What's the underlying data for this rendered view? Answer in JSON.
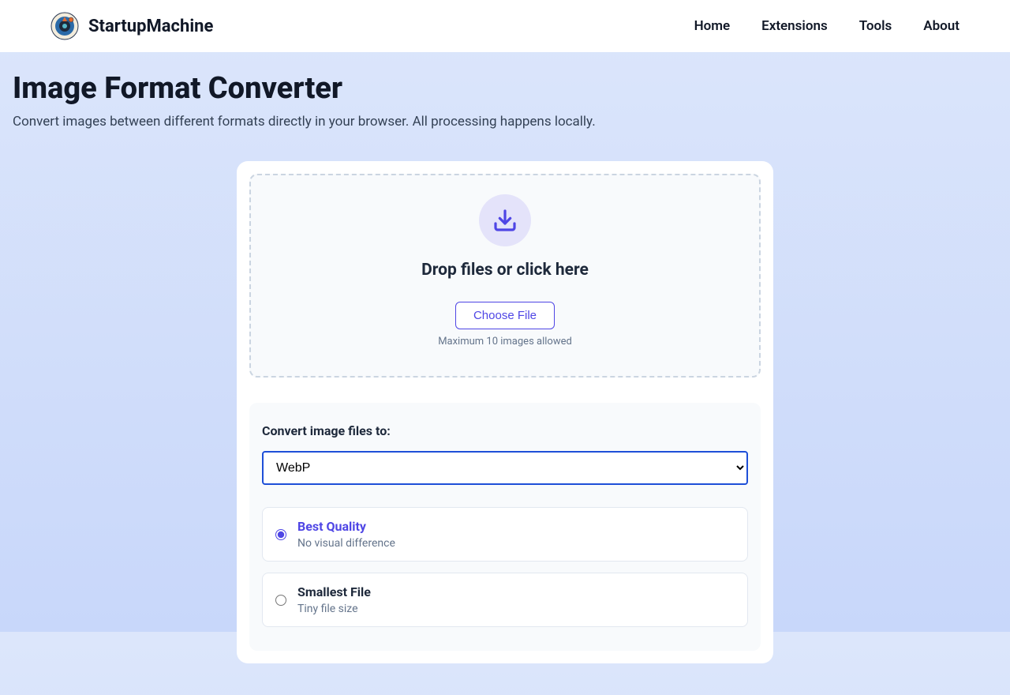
{
  "header": {
    "brand": "StartupMachine",
    "nav": {
      "home": "Home",
      "extensions": "Extensions",
      "tools": "Tools",
      "about": "About"
    }
  },
  "page": {
    "title": "Image Format Converter",
    "subtitle": "Convert images between different formats directly in your browser. All processing happens locally."
  },
  "dropzone": {
    "heading": "Drop files or click here",
    "button": "Choose File",
    "note": "Maximum 10 images allowed"
  },
  "options": {
    "label": "Convert image files to:",
    "selected": "WebP",
    "quality": {
      "best": {
        "title": "Best Quality",
        "sub": "No visual difference"
      },
      "small": {
        "title": "Smallest File",
        "sub": "Tiny file size"
      }
    }
  }
}
